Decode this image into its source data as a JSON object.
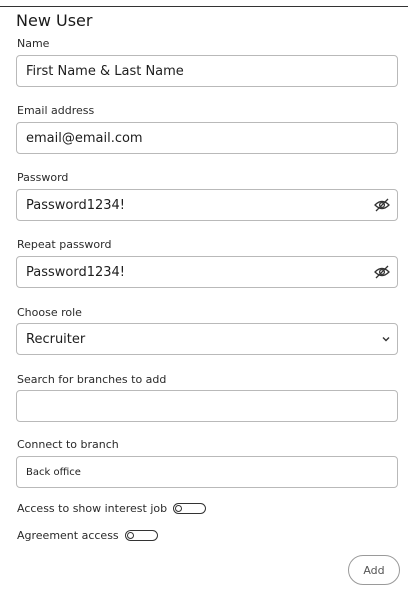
{
  "form": {
    "title": "New User",
    "name": {
      "label": "Name",
      "value": "First Name & Last Name"
    },
    "email": {
      "label": "Email address",
      "value": "email@email.com"
    },
    "password": {
      "label": "Password",
      "value": "Password1234!"
    },
    "repeat_password": {
      "label": "Repeat password",
      "value": "Password1234!"
    },
    "role": {
      "label": "Choose role",
      "selected": "Recruiter"
    },
    "branch_search": {
      "label": "Search for branches to add",
      "value": "",
      "placeholder": ""
    },
    "connect_branch": {
      "label": "Connect to branch",
      "value": "Back office"
    },
    "access_interest": {
      "label": "Access to show interest job",
      "on": false
    },
    "agreement_access": {
      "label": "Agreement access",
      "on": false
    },
    "add_label": "Add"
  },
  "icons": {
    "eye_hidden": "eye-off-icon",
    "dropdown": "chevron-down-icon"
  }
}
